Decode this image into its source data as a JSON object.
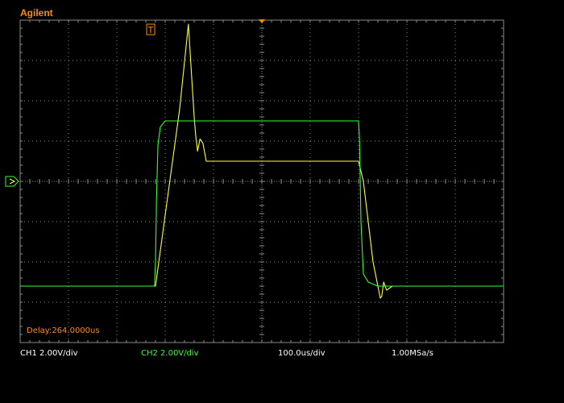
{
  "brand": "Agilent",
  "colors": {
    "background": "#000000",
    "grid": "#8a8a8a",
    "ch1": "#ffff33",
    "ch2": "#33ff33",
    "brand": "#ff8c00",
    "delay": "#ff8c00",
    "status_text": "#ffffff"
  },
  "trigger_marker": "T",
  "status": {
    "ch1_label": "CH1 2.00V/div",
    "ch2_label": "CH2 2.00V/div",
    "timebase": "100.0us/div",
    "sample_rate": "1.00MSa/s"
  },
  "delay_label": "Delay:264.0000us",
  "chart_data": {
    "type": "line",
    "title": "",
    "xlabel": "",
    "ylabel": "",
    "x_divisions": 10,
    "y_divisions": 8,
    "x_units": "divisions",
    "y_units": "divisions",
    "xlim": [
      0,
      10
    ],
    "ylim": [
      -4,
      4
    ],
    "grid": true,
    "ground_marker_level": 0,
    "trigger_position": 2.8,
    "series": [
      {
        "channel": "CH1",
        "color": "#ffff33",
        "x": [
          0,
          2.8,
          3.3,
          3.48,
          3.6,
          3.63,
          3.67,
          3.72,
          3.78,
          3.85,
          4.0,
          7.0,
          7.1,
          7.2,
          7.3,
          7.45,
          7.48,
          7.52,
          7.58,
          7.7,
          7.8,
          10
        ],
        "y": [
          -2.6,
          -2.6,
          1.8,
          3.9,
          1.6,
          1.15,
          0.75,
          1.05,
          0.95,
          0.5,
          0.5,
          0.5,
          0.0,
          -1.0,
          -2.0,
          -2.9,
          -2.85,
          -2.5,
          -2.7,
          -2.6,
          -2.6,
          -2.6
        ]
      },
      {
        "channel": "CH2",
        "color": "#33ff33",
        "x": [
          0,
          2.78,
          2.8,
          2.82,
          2.85,
          2.9,
          3.0,
          7.0,
          7.02,
          7.05,
          7.1,
          7.2,
          7.4,
          10
        ],
        "y": [
          -2.6,
          -2.6,
          -2.0,
          -0.5,
          0.9,
          1.35,
          1.5,
          1.5,
          1.0,
          -1.0,
          -2.3,
          -2.5,
          -2.6,
          -2.6
        ]
      }
    ]
  }
}
